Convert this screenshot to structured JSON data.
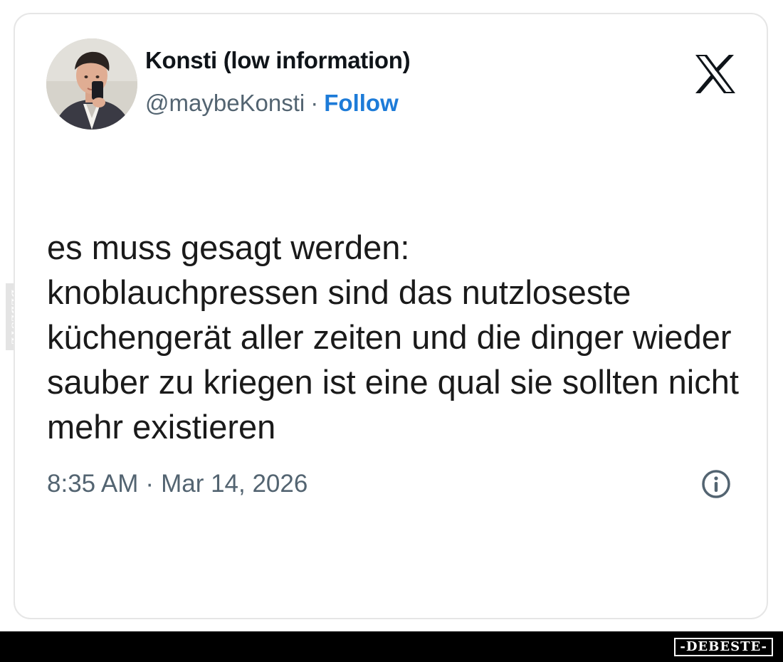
{
  "tweet": {
    "author": {
      "name": "Konsti (low information)",
      "handle": "@maybeKonsti",
      "separator": "·",
      "follow_label": "Follow"
    },
    "text": "es muss gesagt werden:\nknoblauchpressen sind das nutzloseste küchengerät aller zeiten und die dinger wieder sauber zu kriegen ist eine qual sie sollten nicht mehr existieren",
    "time": "8:35 AM",
    "separator": "·",
    "date": "Mar 14, 2026"
  },
  "icons": {
    "platform_logo": "x-logo-icon",
    "info": "info-icon"
  },
  "watermark": {
    "side_text": "DEBESTE",
    "badge_text": "-DEBESTE-"
  },
  "colors": {
    "follow_link": "#1d7bd8",
    "name_text": "#0f1419",
    "meta_text": "#536471",
    "tweet_text": "#1a1a1a",
    "card_border": "#e6e6e6",
    "bottom_bar": "#000000"
  }
}
